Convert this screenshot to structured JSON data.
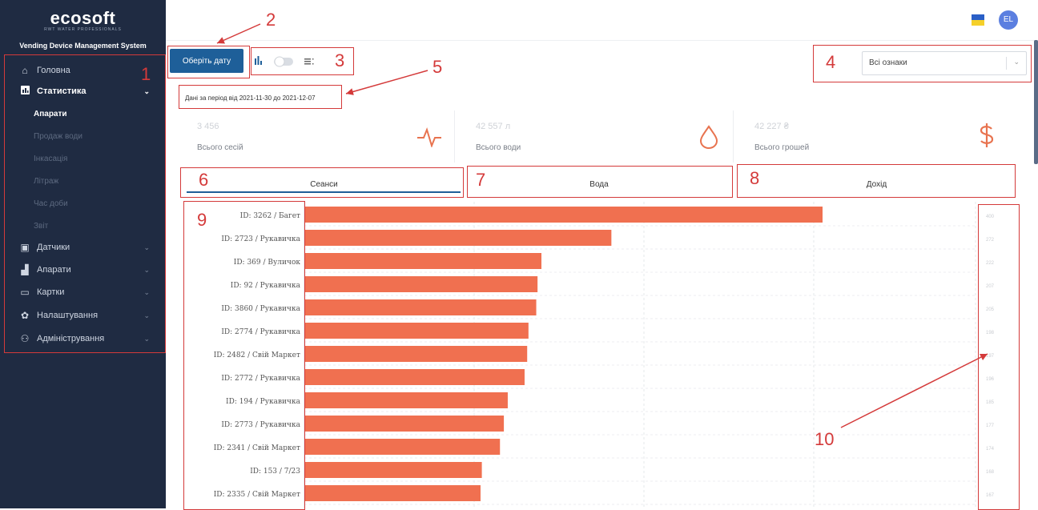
{
  "sidebar": {
    "logo": "ecosoft",
    "logo_tag": "RWT WATER PROFESSIONALS",
    "system_name": "Vending Device Management System",
    "items": [
      {
        "label": "Головна",
        "icon": "home-icon"
      },
      {
        "label": "Статистика",
        "icon": "chart-icon"
      },
      {
        "label": "Датчики",
        "icon": "sensor-icon"
      },
      {
        "label": "Апарати",
        "icon": "machine-icon"
      },
      {
        "label": "Картки",
        "icon": "card-icon"
      },
      {
        "label": "Налаштування",
        "icon": "gear-icon"
      },
      {
        "label": "Адміністрування",
        "icon": "users-icon"
      }
    ],
    "subitems": [
      "Апарати",
      "Продаж води",
      "Інкасація",
      "Літраж",
      "Час доби",
      "Звіт"
    ]
  },
  "header": {
    "avatar_initials": "EL",
    "flag_colors": [
      "#2a5fc7",
      "#f5d02a"
    ]
  },
  "toolbar": {
    "pick_date_label": "Оберіть дату",
    "filter_selected": "Всі ознаки"
  },
  "period_text": "Дані за період від 2021-11-30 до 2021-12-07",
  "stats": [
    {
      "value": "3 456",
      "label": "Всього сесій",
      "icon": "pulse-icon"
    },
    {
      "value": "42 557 л",
      "label": "Всього води",
      "icon": "drop-icon"
    },
    {
      "value": "42 227 ₴",
      "label": "Всього грошей",
      "icon": "dollar-icon"
    }
  ],
  "tabs": [
    "Сеанси",
    "Вода",
    "Дохід"
  ],
  "annotations": [
    "1",
    "2",
    "3",
    "4",
    "5",
    "6",
    "7",
    "8",
    "9",
    "10"
  ],
  "colors": {
    "sidebar": "#1f2b42",
    "accent": "#1e5f99",
    "bar": "#f07050",
    "annotation": "#d43a3a"
  },
  "chart_data": {
    "type": "bar",
    "orientation": "horizontal",
    "categories": [
      "ID: 3262 / Багет",
      "ID: 2723 / Рукавичка",
      "ID: 369 / Вуличок",
      "ID: 92 / Рукавичка",
      "ID: 3860 / Рукавичка",
      "ID: 2774 / Рукавичка",
      "ID: 2482 / Свій Маркет",
      "ID: 2772 / Рукавичка",
      "ID: 194 / Рукавичка",
      "ID: 2773 / Рукавичка",
      "ID: 2341 / Свій Маркет",
      "ID: 153 / 7/23",
      "ID: 2335 / Свій Маркет"
    ],
    "values": [
      400,
      237,
      183,
      180,
      179,
      173,
      172,
      170,
      157,
      154,
      151,
      137,
      136
    ],
    "value_labels": [
      "400",
      "272",
      "222",
      "207",
      "205",
      "198",
      "197",
      "196",
      "185",
      "177",
      "174",
      "168",
      "167"
    ],
    "xlim": [
      0,
      520
    ],
    "grid": true,
    "title": "",
    "xlabel": "",
    "ylabel": ""
  }
}
